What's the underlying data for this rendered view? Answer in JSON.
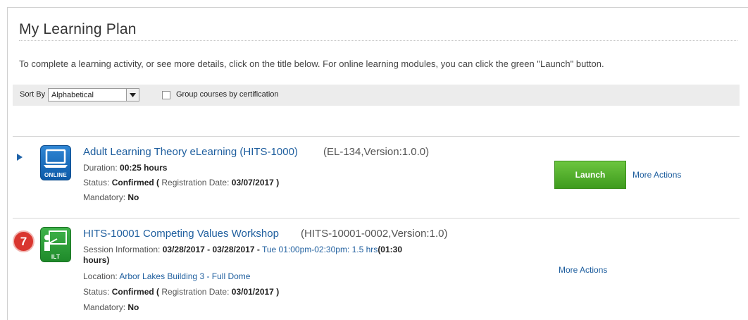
{
  "page": {
    "title": "My Learning Plan",
    "instructions": "To complete a learning activity, or see more details, click on the title below. For online learning modules, you can click the green \"Launch\" button."
  },
  "sort": {
    "label": "Sort By",
    "selected": "Alphabetical",
    "group_label": "Group courses by certification",
    "group_checked": false
  },
  "courses": [
    {
      "icon": "online-laptop-icon",
      "icon_caption": "ONLINE",
      "title": "Adult Learning Theory eLearning (HITS-1000)",
      "code": "(EL-134,Version:1.0.0)",
      "duration_label": "Duration:",
      "duration_value": "00:25 hours",
      "status_label": "Status:",
      "status_value": "Confirmed",
      "reg_open": "(",
      "reg_label": "Registration Date:",
      "reg_value": "03/07/2017",
      "reg_close": ")",
      "mandatory_label": "Mandatory:",
      "mandatory_value": "No",
      "launch_label": "Launch",
      "more_actions": "More Actions"
    },
    {
      "icon": "ilt-classroom-icon",
      "icon_caption": "ILT",
      "badge": "7",
      "title": "HITS-10001 Competing Values Workshop",
      "code": "(HITS-10001-0002,Version:1.0)",
      "session_label": "Session Information:",
      "session_dates": "03/28/2017 - 03/28/2017 -",
      "session_time": "Tue 01:00pm-02:30pm: 1.5 hrs",
      "session_hours_a": "(01:30",
      "session_hours_b": "hours)",
      "location_label": "Location:",
      "location_value": "Arbor Lakes Building 3 - Full Dome",
      "status_label": "Status:",
      "status_value": "Confirmed",
      "reg_open": "(",
      "reg_label": "Registration Date:",
      "reg_value": "03/01/2017",
      "reg_close": ")",
      "mandatory_label": "Mandatory:",
      "mandatory_value": "No",
      "more_actions": "More Actions"
    }
  ],
  "colors": {
    "link": "#1e5e9e",
    "launch_green": "#4caf2a",
    "online_blue": "#1a6ebf",
    "ilt_green": "#2e9e3a",
    "badge_red": "#d9362f"
  }
}
